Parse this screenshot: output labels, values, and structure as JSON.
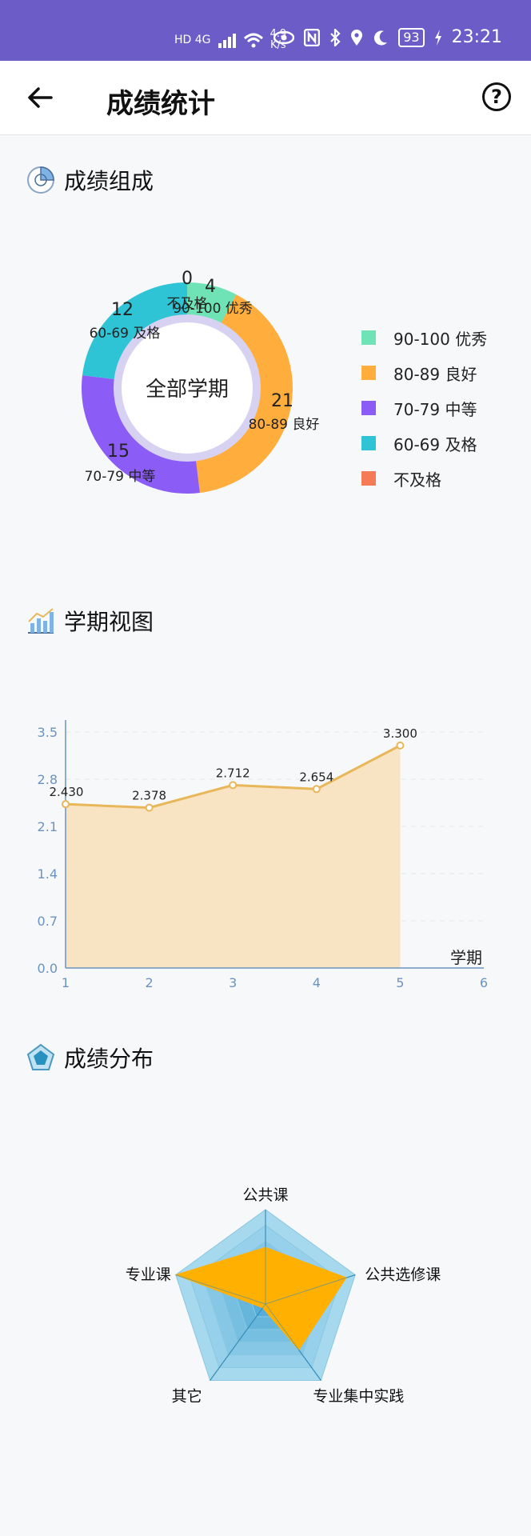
{
  "status_bar": {
    "network": "HD 4G",
    "speed_value": "4.9",
    "speed_unit": "K/s",
    "battery": "93",
    "time": "23:21"
  },
  "header": {
    "title": "成绩统计"
  },
  "sections": {
    "composition": "成绩组成",
    "semester_view": "学期视图",
    "distribution": "成绩分布"
  },
  "donut": {
    "center_label": "全部学期",
    "colors": [
      "#6fe3b5",
      "#ffae3e",
      "#8b5cf6",
      "#2ec4d6",
      "#f47b55"
    ],
    "slices": [
      {
        "label": "90-100 优秀",
        "value": 4
      },
      {
        "label": "80-89 良好",
        "value": 21
      },
      {
        "label": "70-79 中等",
        "value": 15
      },
      {
        "label": "60-69 及格",
        "value": 12
      },
      {
        "label": "不及格",
        "value": 0
      }
    ],
    "legend": [
      "90-100 优秀",
      "80-89 良好",
      "70-79 中等",
      "60-69 及格",
      "不及格"
    ]
  },
  "chart_data": [
    {
      "type": "area",
      "x": [
        1,
        2,
        3,
        4,
        5
      ],
      "y": [
        2.43,
        2.378,
        2.712,
        2.654,
        3.3
      ],
      "data_labels": [
        "2.430",
        "2.378",
        "2.712",
        "2.654",
        "3.300"
      ],
      "xlim": [
        1,
        6
      ],
      "ylim": [
        0,
        3.5
      ],
      "xticks": [
        "1",
        "2",
        "3",
        "4",
        "5",
        "6"
      ],
      "yticks": [
        "0.0",
        "0.7",
        "1.4",
        "2.1",
        "2.8",
        "3.5"
      ],
      "xlabel": "学期",
      "line_color": "#e8b75a",
      "fill_color": "#f7e0bb"
    },
    {
      "type": "radar",
      "axes": [
        "公共课",
        "公共选修课",
        "专业集中实践",
        "其它",
        "专业课"
      ],
      "values": [
        0.6,
        0.9,
        0.6,
        0.05,
        1.0
      ],
      "max": 1,
      "fill_color": "#ffb000"
    }
  ]
}
